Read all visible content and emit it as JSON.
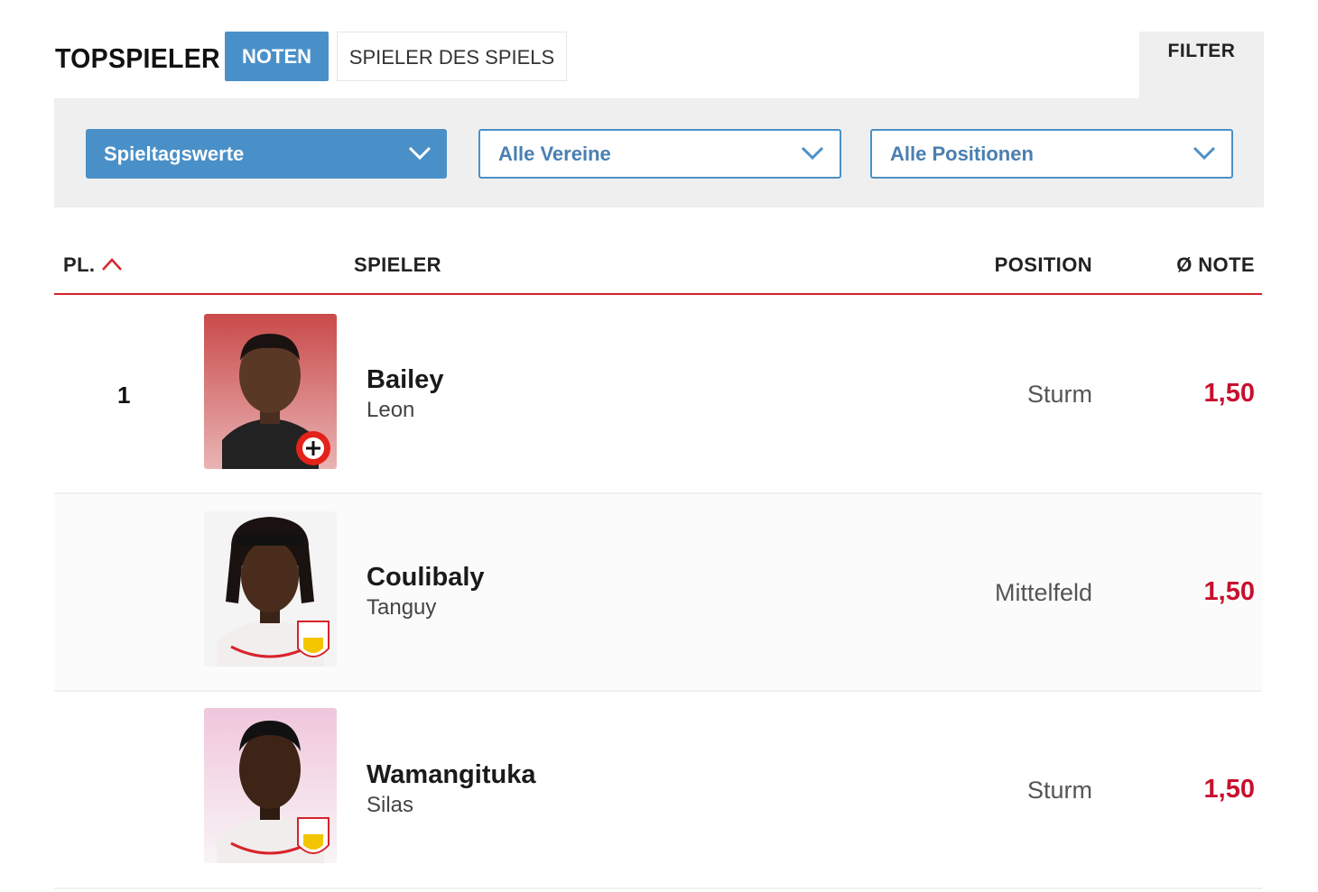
{
  "header": {
    "title": "TOPSPIELER",
    "tabs": [
      {
        "label": "NOTEN",
        "active": true
      },
      {
        "label": "SPIELER DES SPIELS",
        "active": false
      }
    ],
    "filter_label": "FILTER"
  },
  "filters": {
    "spieltag": "Spieltagswerte",
    "vereine": "Alle Vereine",
    "positionen": "Alle Positionen"
  },
  "table": {
    "headers": {
      "rank": "PL.",
      "player": "SPIELER",
      "position": "POSITION",
      "rating": "Ø NOTE"
    },
    "sort_icon": "chevron-up-icon",
    "rows": [
      {
        "rank": "1",
        "last_name": "Bailey",
        "first_name": "Leon",
        "position": "Sturm",
        "rating": "1,50"
      },
      {
        "rank": "",
        "last_name": "Coulibaly",
        "first_name": "Tanguy",
        "position": "Mittelfeld",
        "rating": "1,50"
      },
      {
        "rank": "",
        "last_name": "Wamangituka",
        "first_name": "Silas",
        "position": "Sturm",
        "rating": "1,50"
      }
    ]
  },
  "colors": {
    "accent_blue": "#4a90c8",
    "accent_red": "#c8102e",
    "divider_red": "#d8232a",
    "panel_grey": "#efefef"
  }
}
